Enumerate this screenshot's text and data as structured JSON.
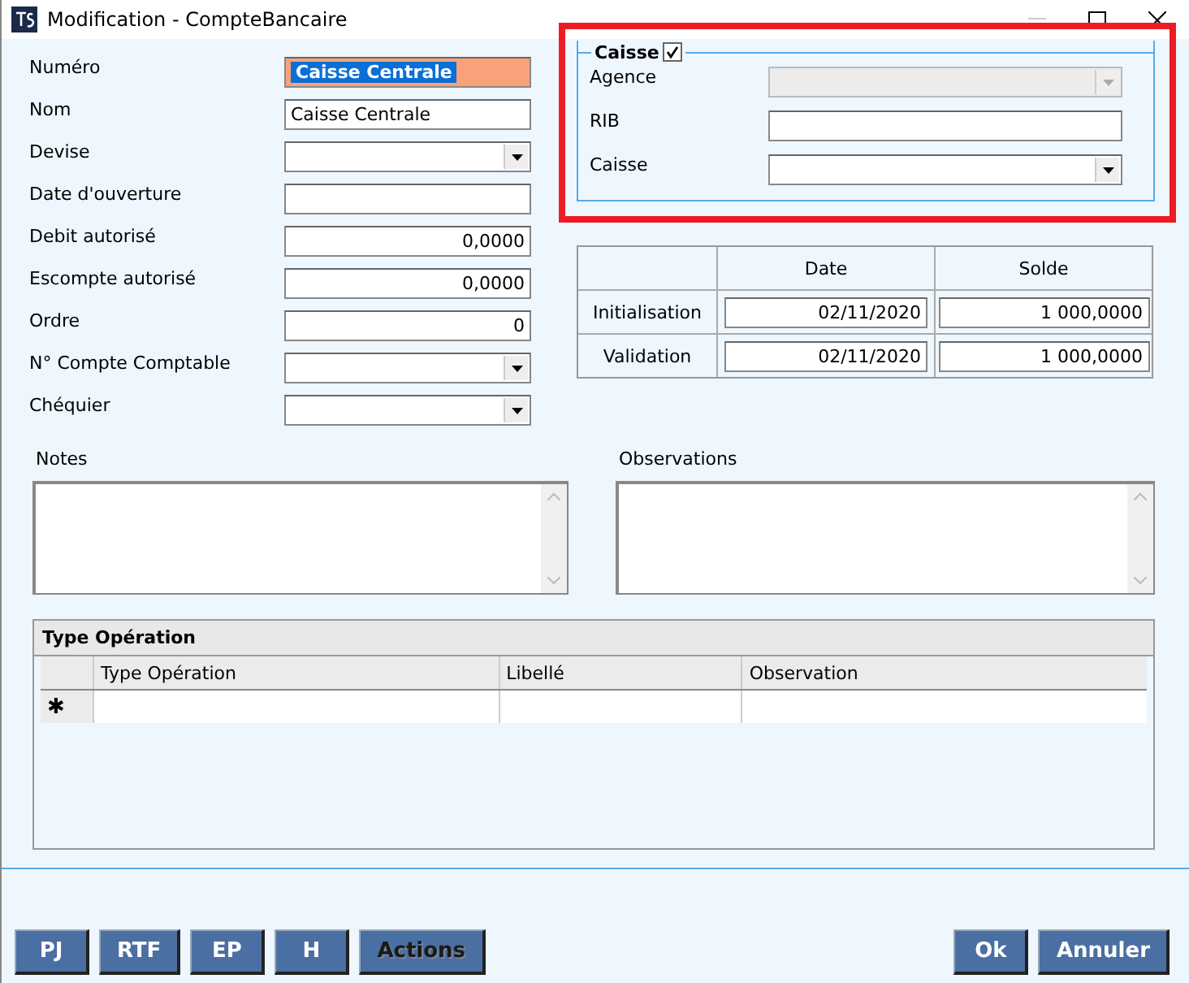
{
  "window": {
    "title": "Modification - CompteBancaire"
  },
  "fields": [
    {
      "label": "Numéro",
      "kind": "text",
      "value": "Caisse Centrale",
      "focused": true
    },
    {
      "label": "Nom",
      "kind": "text",
      "value": "Caisse Centrale",
      "focused": false
    },
    {
      "label": "Devise",
      "kind": "combo",
      "focused": false
    },
    {
      "label": "Date d'ouverture",
      "kind": "text",
      "focused": false
    },
    {
      "label": "Debit autorisé",
      "kind": "number",
      "value": "0,0000",
      "focused": false
    },
    {
      "label": "Escompte autorisé",
      "kind": "number",
      "value": "0,0000",
      "focused": false
    },
    {
      "label": "Ordre",
      "kind": "number",
      "value": "0",
      "focused": false
    },
    {
      "label": "N° Compte Comptable",
      "kind": "combo",
      "focused": false
    },
    {
      "label": "Chéquier",
      "kind": "combo",
      "focused": false
    }
  ],
  "caisse_group": {
    "title": "Caisse",
    "checked": true,
    "fields": [
      {
        "label": "Agence",
        "kind": "combo",
        "disabled": true
      },
      {
        "label": "RIB",
        "kind": "text",
        "disabled": false
      },
      {
        "label": "Caisse",
        "kind": "combo",
        "disabled": false
      }
    ]
  },
  "balance_table": {
    "columns": [
      "Date",
      "Solde"
    ],
    "rows": [
      {
        "label": "Initialisation",
        "date": "02/11/2020",
        "solde": "1 000,0000"
      },
      {
        "label": "Validation",
        "date": "02/11/2020",
        "solde": "1 000,0000"
      }
    ]
  },
  "notes": {
    "label": "Notes"
  },
  "observations": {
    "label": "Observations"
  },
  "grid": {
    "title": "Type Opération",
    "columns": [
      "Type Opération",
      "Libellé",
      "Observation"
    ],
    "new_row_marker": "✱"
  },
  "buttons_left": [
    {
      "label": "PJ",
      "disabled": false
    },
    {
      "label": "RTF",
      "disabled": false
    },
    {
      "label": "EP",
      "disabled": false
    },
    {
      "label": "H",
      "disabled": false
    },
    {
      "label": "Actions",
      "disabled": true
    }
  ],
  "buttons_right": [
    {
      "label": "Ok",
      "disabled": false
    },
    {
      "label": "Annuler",
      "disabled": false
    }
  ]
}
